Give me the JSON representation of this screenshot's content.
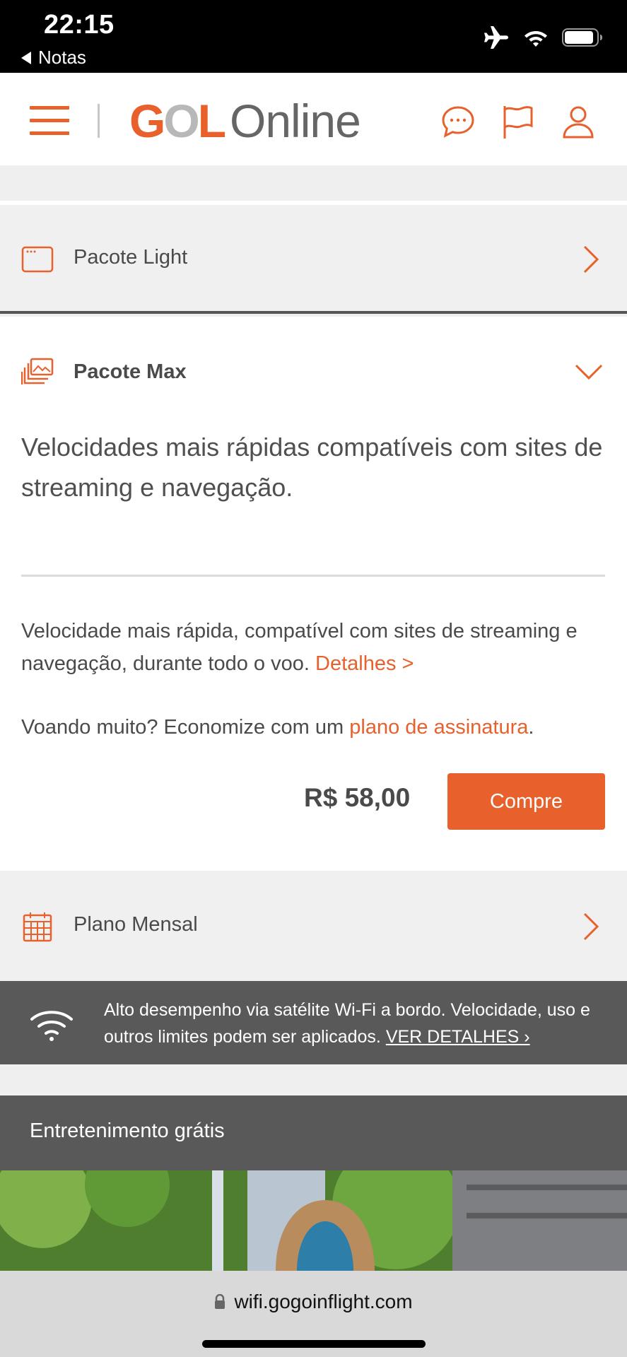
{
  "status_bar": {
    "time": "22:15",
    "back_label": "Notas",
    "icons": [
      "airplane-mode-icon",
      "wifi-icon",
      "battery-icon"
    ]
  },
  "header": {
    "logo_gol": "GOL",
    "logo_online": "Online",
    "icons": [
      "menu-icon",
      "chat-icon",
      "flag-icon",
      "user-icon"
    ]
  },
  "packages": {
    "light": {
      "label": "Pacote Light",
      "icon": "browser-window-icon",
      "expanded": false
    },
    "max": {
      "label": "Pacote Max",
      "icon": "media-gallery-icon",
      "expanded": true,
      "description": "Velocidades mais rápidas compatíveis com sites de streaming e navegação.",
      "details_text": "Velocidade mais rápida, compatível com sites de streaming e navegação, durante todo o voo.",
      "details_link": "Detalhes >",
      "subscribe_prefix": "Voando muito? Economize com um",
      "subscribe_link": "plano de assinatura",
      "subscribe_suffix": ".",
      "price": "R$ 58,00",
      "buy_label": "Compre"
    },
    "mensal": {
      "label": "Plano Mensal",
      "icon": "calendar-icon",
      "expanded": false
    }
  },
  "wifi_banner": {
    "text": "Alto desempenho via satélite Wi-Fi a bordo. Velocidade, uso e outros limites podem ser aplicados.",
    "link": "VER DETALHES ›"
  },
  "entertainment": {
    "title": "Entretenimento grátis"
  },
  "browser": {
    "url": "wifi.gogoinflight.com"
  },
  "colors": {
    "accent": "#e8602c",
    "dark_band": "#595959",
    "row_bg": "#f0f0f0"
  }
}
